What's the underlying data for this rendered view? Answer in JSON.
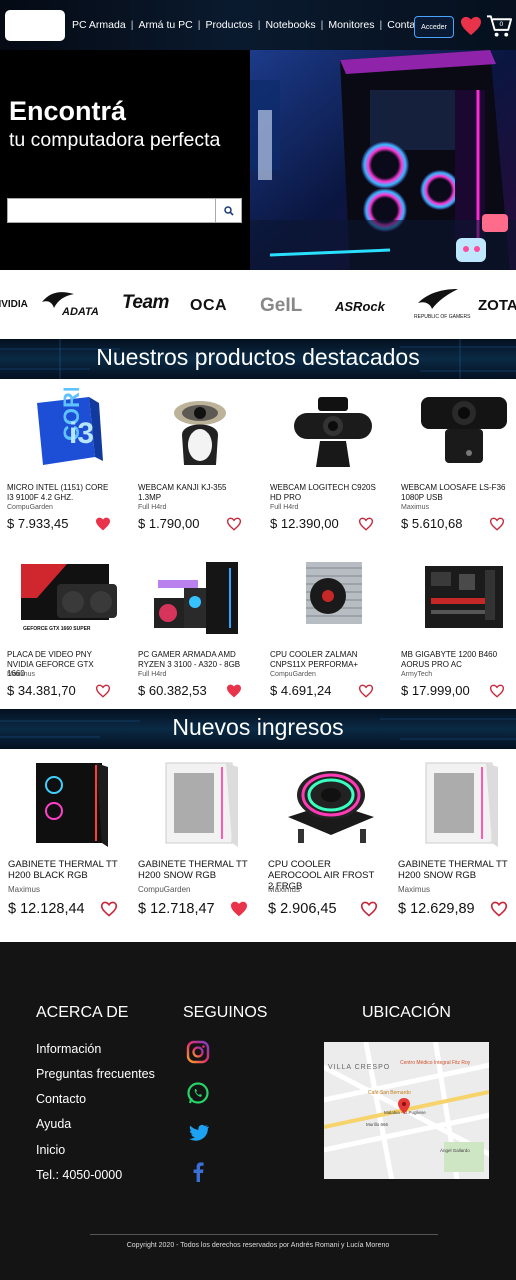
{
  "nav": {
    "links": [
      "PC Armada",
      "Armá tu PC",
      "Productos",
      "Notebooks",
      "Monitores",
      "Contacto"
    ],
    "login_label": "Acceder",
    "cart_count": "0",
    "accent": "#4aa3ff",
    "heart_color": "#e8334a"
  },
  "hero": {
    "title": "Encontrá",
    "subtitle": "tu computadora perfecta",
    "search_placeholder": "",
    "search_icon": "search-icon"
  },
  "brands": [
    "NVIDIA",
    "ADATA",
    "Team",
    "OCA",
    "GeIL",
    "ASRock",
    "REPUBLIC OF GAMERS",
    "ZOTAC"
  ],
  "featured": {
    "title": "Nuestros productos destacados",
    "products": [
      {
        "name": "MICRO INTEL (1151) CORE I3 9100F 4.2 GHZ.",
        "seller": "CompuGarden",
        "price": "$ 7.933,45",
        "favorited": true
      },
      {
        "name": "WEBCAM KANJI KJ-355 1.3MP",
        "seller": "Full H4rd",
        "price": "$ 1.790,00",
        "favorited": false
      },
      {
        "name": "WEBCAM LOGITECH C920S HD PRO",
        "seller": "Full H4rd",
        "price": "$ 12.390,00",
        "favorited": false
      },
      {
        "name": "WEBCAM LOOSAFE LS-F36 1080P USB",
        "seller": "Maximus",
        "price": "$ 5.610,68",
        "favorited": false
      },
      {
        "name": "PLACA DE VIDEO PNY NVIDIA GEFORCE GTX 1660",
        "seller": "Maximus",
        "price": "$ 34.381,70",
        "favorited": false
      },
      {
        "name": "PC GAMER ARMADA AMD RYZEN 3 3100 - A320 - 8GB -",
        "seller": "Full H4rd",
        "price": "$ 60.382,53",
        "favorited": true
      },
      {
        "name": "CPU COOLER ZALMAN CNPS11X PERFORMA+",
        "seller": "CompuGarden",
        "price": "$ 4.691,24",
        "favorited": false
      },
      {
        "name": "MB GIGABYTE 1200 B460 AORUS PRO AC",
        "seller": "ArmyTech",
        "price": "$ 17.999,00",
        "favorited": false
      }
    ]
  },
  "new_arrivals": {
    "title": "Nuevos ingresos",
    "products": [
      {
        "name": "GABINETE THERMAL TT H200 BLACK RGB",
        "seller": "Maximus",
        "price": "$ 12.128,44",
        "favorited": false
      },
      {
        "name": "GABINETE THERMAL TT H200 SNOW RGB",
        "seller": "CompuGarden",
        "price": "$ 12.718,47",
        "favorited": true
      },
      {
        "name": "CPU COOLER AEROCOOL AIR FROST 2 FRGB",
        "seller": "Maximus",
        "price": "$ 2.906,45",
        "favorited": false
      },
      {
        "name": "GABINETE THERMAL TT H200 SNOW RGB",
        "seller": "Maximus",
        "price": "$ 12.629,89",
        "favorited": false
      }
    ]
  },
  "footer": {
    "about_title": "ACERCA DE",
    "about_links": [
      "Información",
      "Preguntas frecuentes",
      "Contacto",
      "Ayuda",
      "Inicio",
      "Tel.: 4050-0000"
    ],
    "follow_title": "SEGUINOS",
    "social": [
      "instagram-icon",
      "whatsapp-icon",
      "twitter-icon",
      "facebook-icon"
    ],
    "location_title": "UBICACIÓN",
    "map_labels": [
      "VILLA CRESPO",
      "Centro Médico Integral Fitz Roy",
      "Café San Bernardo",
      "Malabia - O.Pugliese",
      "Murillo 666",
      "Ángel Gallardo"
    ],
    "copyright": "Copyright 2020 - Todos los derechos reservados por Andrés Romani y Lucía Moreno"
  }
}
